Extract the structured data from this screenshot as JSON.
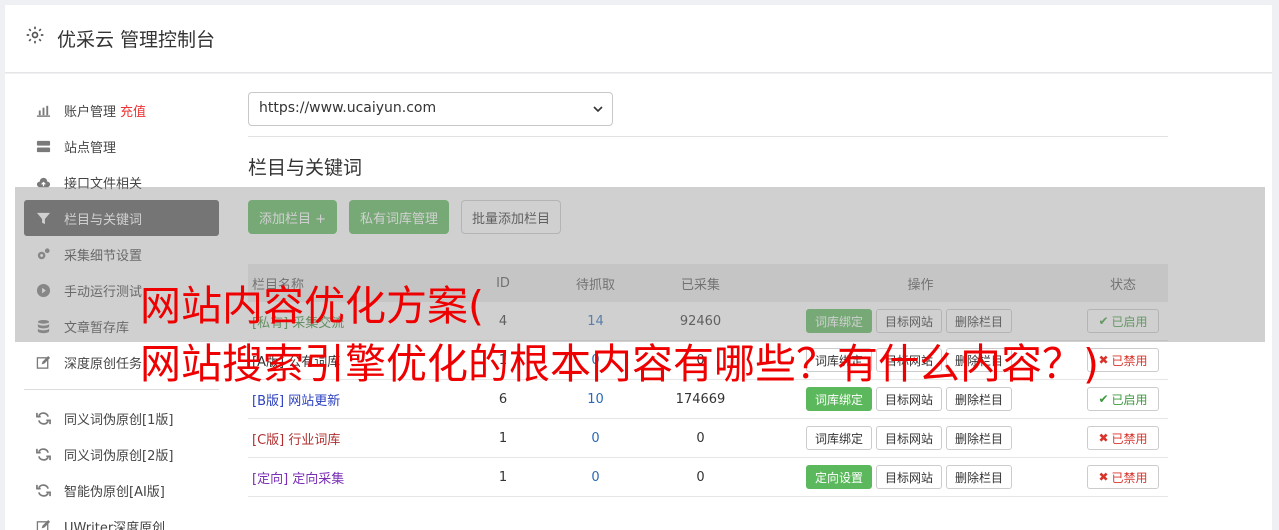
{
  "header": {
    "title": "优采云 管理控制台"
  },
  "sidebar": {
    "items": [
      {
        "label": "账户管理",
        "extra": "充值",
        "icon": "bar-chart-icon"
      },
      {
        "label": "站点管理",
        "icon": "server-icon"
      },
      {
        "label": "接口文件相关",
        "icon": "cloud-upload-icon"
      },
      {
        "label": "栏目与关键词",
        "icon": "filter-icon",
        "active": true
      },
      {
        "label": "采集细节设置",
        "icon": "gears-icon"
      },
      {
        "label": "手动运行测试",
        "icon": "play-circle-icon"
      },
      {
        "label": "文章暂存库",
        "icon": "database-icon"
      },
      {
        "label": "深度原创任务",
        "icon": "edit-icon"
      }
    ],
    "items2": [
      {
        "label": "同义词伪原创[1版]",
        "icon": "refresh-icon"
      },
      {
        "label": "同义词伪原创[2版]",
        "icon": "refresh-icon"
      },
      {
        "label": "智能伪原创[AI版]",
        "icon": "refresh-icon"
      },
      {
        "label": "UWriter深度原创",
        "icon": "edit-icon"
      }
    ]
  },
  "main": {
    "site_select": "https://www.ucaiyun.com",
    "section_title": "栏目与关键词",
    "buttons": {
      "add_column": "添加栏目 +",
      "private_lib": "私有词库管理",
      "batch_add": "批量添加栏目"
    },
    "table": {
      "headers": {
        "name": "栏目名称",
        "id": "ID",
        "pending": "待抓取",
        "collected": "已采集",
        "ops": "操作",
        "status": "状态"
      },
      "rows": [
        {
          "tag": "[私有]",
          "name": "采集交流",
          "id": "4",
          "pending": "14",
          "collected": "92460",
          "op1": "词库绑定",
          "op1_green": true,
          "op2": "目标网站",
          "op3": "删除栏目",
          "status": "已启用",
          "enabled": true,
          "color": "#3c8a3c"
        },
        {
          "tag": "[A版]",
          "name": "公有词库",
          "id": "1",
          "pending": "0",
          "collected": "0",
          "op1": "词库绑定",
          "op1_green": false,
          "op2": "目标网站",
          "op3": "删除栏目",
          "status": "已禁用",
          "enabled": false,
          "color": "#333333"
        },
        {
          "tag": "[B版]",
          "name": "网站更新",
          "id": "6",
          "pending": "10",
          "collected": "174669",
          "op1": "词库绑定",
          "op1_green": true,
          "op2": "目标网站",
          "op3": "删除栏目",
          "status": "已启用",
          "enabled": true,
          "color": "#2a3fbf"
        },
        {
          "tag": "[C版]",
          "name": "行业词库",
          "id": "1",
          "pending": "0",
          "collected": "0",
          "op1": "词库绑定",
          "op1_green": false,
          "op2": "目标网站",
          "op3": "删除栏目",
          "status": "已禁用",
          "enabled": false,
          "color": "#b03030"
        },
        {
          "tag": "[定向]",
          "name": "定向采集",
          "id": "1",
          "pending": "0",
          "collected": "0",
          "op1": "定向设置",
          "op1_green": true,
          "op2": "目标网站",
          "op3": "删除栏目",
          "status": "已禁用",
          "enabled": false,
          "color": "#7a2fb5"
        }
      ]
    }
  },
  "watermark": {
    "line1": "网站内容优化方案(",
    "line2": "网站搜索引擎优化的根本内容有哪些？有什么内容？)"
  },
  "colors": {
    "green": "#5cb85c",
    "active_bg": "#5a5a5a",
    "red": "#ee0000"
  }
}
